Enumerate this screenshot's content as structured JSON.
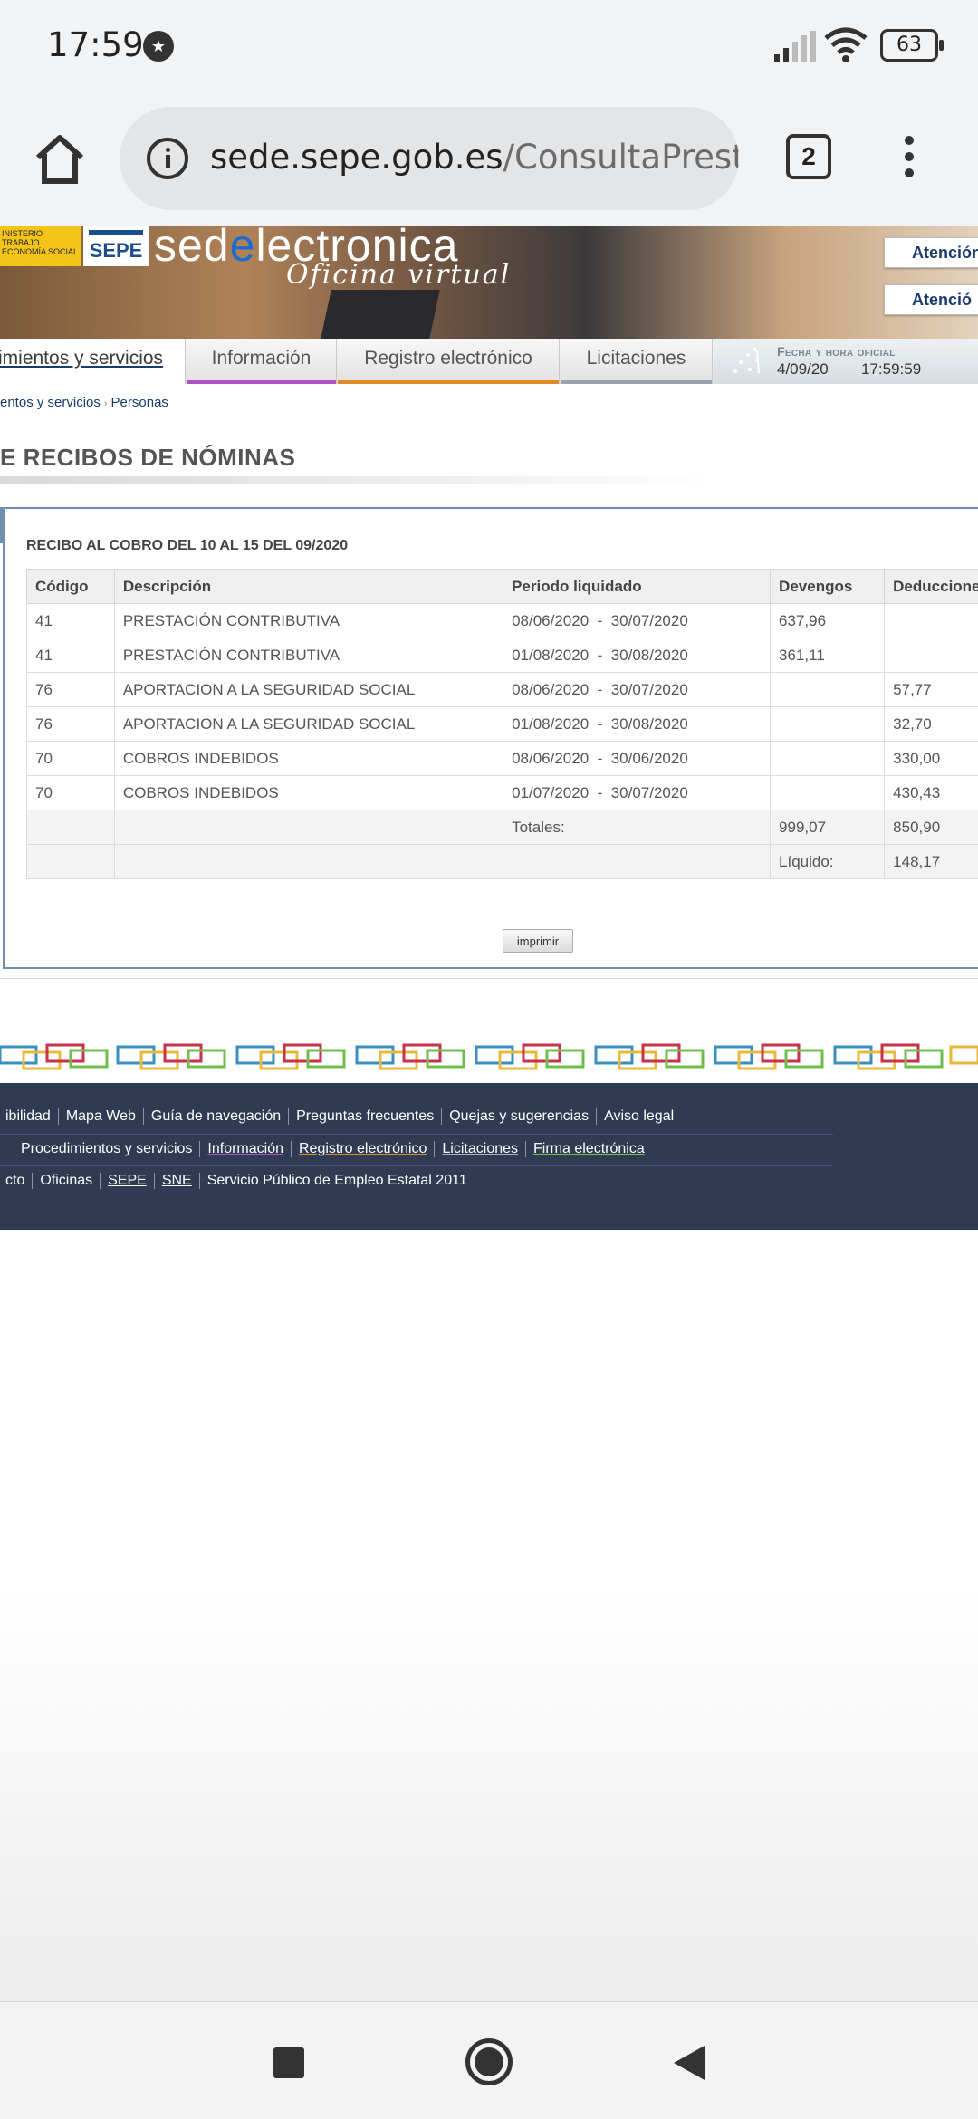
{
  "status_bar": {
    "time": "17:59",
    "notification_icon": "star-circle-icon",
    "battery": "63"
  },
  "browser": {
    "url_domain": "sede.sepe.gob.es",
    "url_path": "/ConsultaPrestac",
    "tab_count": "2"
  },
  "banner": {
    "ministry_text": "INISTERIO\nTRABAJO\nECONOMÍA SOCIAL",
    "sepe_logo": "SEPE",
    "brand_pre": "sed",
    "brand_e": "e",
    "brand_post": "lectronica",
    "subtitle": "Oficina virtual",
    "atencion_1": "Atención",
    "atencion_2": "Atenció"
  },
  "nav": {
    "tab_procedimientos": "imientos y servicios",
    "tab_informacion": "Información",
    "tab_registro": "Registro electrónico",
    "tab_licitaciones": "Licitaciones",
    "clock_label": "Fecha y hora oficial",
    "clock_date": "4/09/20",
    "clock_time": "17:59:59",
    "colors": {
      "informacion": "#b04fc6",
      "registro": "#e08a2a",
      "licitaciones": "#9aa3b0",
      "procedimientos": "#1a3b6e"
    }
  },
  "breadcrumb": {
    "item_1": "entos y servicios",
    "separator": "›",
    "item_2": "Personas"
  },
  "page_title": "E RECIBOS DE NÓMINAS",
  "receipt": {
    "title": "RECIBO AL COBRO DEL 10 AL 15 DEL 09/2020",
    "columns": [
      "Código",
      "Descripción",
      "Periodo liquidado",
      "Devengos",
      "Deducciones"
    ],
    "rows": [
      [
        "41",
        "PRESTACIÓN CONTRIBUTIVA",
        "08/06/2020  -  30/07/2020",
        "637,96",
        ""
      ],
      [
        "41",
        "PRESTACIÓN CONTRIBUTIVA",
        "01/08/2020  -  30/08/2020",
        "361,11",
        ""
      ],
      [
        "76",
        "APORTACION A LA SEGURIDAD SOCIAL",
        "08/06/2020  -  30/07/2020",
        "",
        "57,77"
      ],
      [
        "76",
        "APORTACION A LA SEGURIDAD SOCIAL",
        "01/08/2020  -  30/08/2020",
        "",
        "32,70"
      ],
      [
        "70",
        "COBROS INDEBIDOS",
        "08/06/2020  -  30/06/2020",
        "",
        "330,00"
      ],
      [
        "70",
        "COBROS INDEBIDOS",
        "01/07/2020  -  30/07/2020",
        "",
        "430,43"
      ]
    ],
    "totals_label": "Totales:",
    "totals_devengos": "999,07",
    "totals_deducciones": "850,90",
    "liquido_label": "Líquido:",
    "liquido_value": "148,17",
    "print_button": "imprimir"
  },
  "footer": {
    "row1": [
      "ibilidad",
      "Mapa Web",
      "Guía de navegación",
      "Preguntas frecuentes",
      "Quejas y sugerencias",
      "Aviso legal"
    ],
    "row2": [
      "",
      "Procedimientos y servicios",
      "Información",
      "Registro electrónico",
      "Licitaciones",
      "Firma electrónica"
    ],
    "row3": [
      "cto",
      "Oficinas",
      "SEPE",
      "SNE",
      "Servicio Público de Empleo Estatal 2011"
    ]
  },
  "android_nav": {
    "recent_icon": "square-recents-icon",
    "home_icon": "circle-home-icon",
    "back_icon": "triangle-back-icon"
  }
}
